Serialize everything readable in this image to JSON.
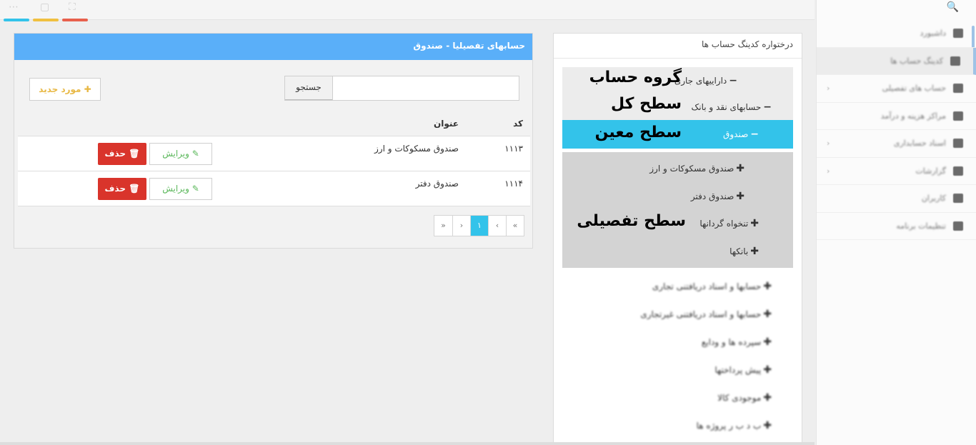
{
  "colors": {
    "accent": "#5aaff9",
    "tree_highlight": "#33c3ea",
    "delete": "#d9342b",
    "edit": "#5cb85c",
    "new": "#e8b844"
  },
  "topbar": {
    "strips": [
      "#33c3ea",
      "#f0c040",
      "#e8604c"
    ]
  },
  "sidebar": {
    "search_icon": "search-icon",
    "items": [
      {
        "label": "داشبورد",
        "icon": "home-icon"
      },
      {
        "label": "کدینگ حساب ها",
        "icon": "table-icon"
      },
      {
        "label": "حساب های تفصیلی",
        "icon": "shield-icon"
      },
      {
        "label": "مراکز هزینه و درآمد",
        "icon": "file-icon"
      },
      {
        "label": "اسناد حسابداری",
        "icon": "file-icon"
      },
      {
        "label": "گزارشات",
        "icon": "chart-icon"
      },
      {
        "label": "کاربران",
        "icon": "user-icon"
      },
      {
        "label": "تنظیمات برنامه",
        "icon": "user-icon"
      }
    ]
  },
  "tree": {
    "title": "درختواره کدینگ حساب ها",
    "nodes": {
      "group": {
        "marker": "−",
        "label": "داراییهای جاری",
        "level": "گروه حساب"
      },
      "ledger": {
        "marker": "−",
        "label": "حسابهای نقد و بانک",
        "level": "سطح کل"
      },
      "subsidiary": {
        "marker": "−",
        "label": "صندوق",
        "level": "سطح معین"
      },
      "details": [
        {
          "marker": "✚",
          "label": "صندوق مسکوکات و ارز"
        },
        {
          "marker": "✚",
          "label": "صندوق دفتر"
        },
        {
          "marker": "✚",
          "label": "تنخواه گردانها"
        },
        {
          "marker": "✚",
          "label": "بانکها"
        }
      ],
      "detail_level": "سطح تفصیلی",
      "others": [
        "حسابها و اسناد دریافتنی تجاری",
        "حسابها و اسناد دریافتنی غیرتجاری",
        "سپرده ها و ودایع",
        "پیش پرداختها",
        "موجودی کالا",
        "ب د ب ر پروژه ها"
      ]
    }
  },
  "detail": {
    "title": "حسابهای تفصیلیا - صندوق",
    "search_button": "جستجو",
    "search_placeholder": "",
    "new_button": "مورد جدید",
    "columns": {
      "code": "کد",
      "title": "عنوان"
    },
    "rows": [
      {
        "code": "۱۱۱۳",
        "title": "صندوق مسکوکات و ارز",
        "edit": "ویرایش",
        "delete": "حذف"
      },
      {
        "code": "۱۱۱۴",
        "title": "صندوق دفتر",
        "edit": "ویرایش",
        "delete": "حذف"
      }
    ],
    "pager": [
      "«",
      "‹",
      "۱",
      "›",
      "»"
    ],
    "current_page": "۱"
  }
}
